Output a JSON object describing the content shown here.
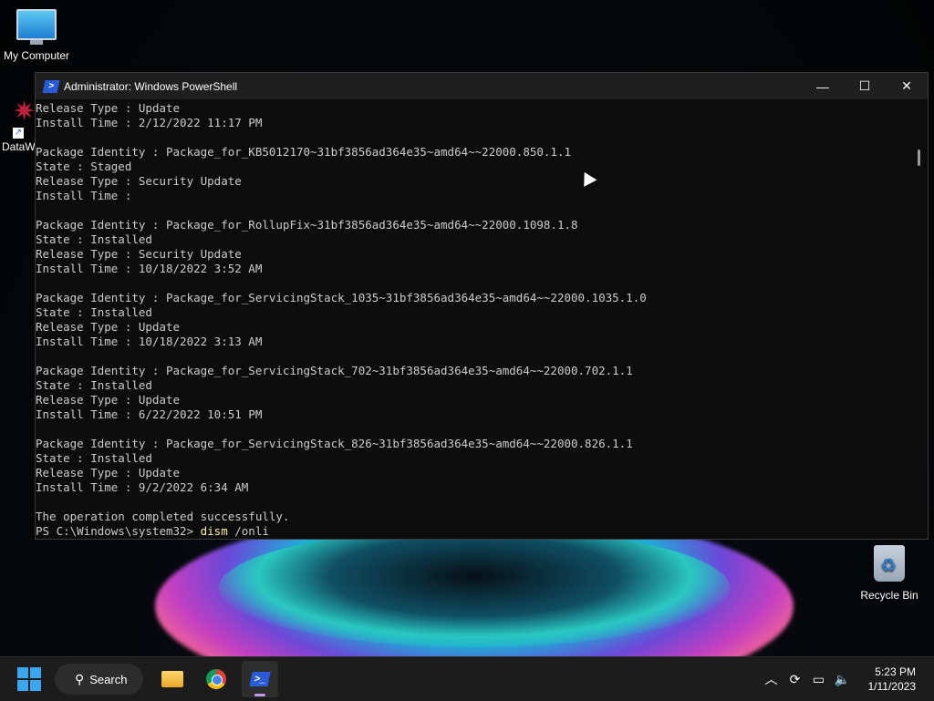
{
  "desktop": {
    "icons": [
      {
        "label": "My Computer"
      },
      {
        "label": "DataW"
      },
      {
        "label": "Recycle Bin"
      }
    ]
  },
  "window": {
    "title": "Administrator: Windows PowerShell",
    "controls": {
      "minimize": "—",
      "maximize": "☐",
      "close": "✕"
    }
  },
  "terminal": {
    "lines": [
      "Release Type : Update",
      "Install Time : 2/12/2022 11:17 PM",
      "",
      "Package Identity : Package_for_KB5012170~31bf3856ad364e35~amd64~~22000.850.1.1",
      "State : Staged",
      "Release Type : Security Update",
      "Install Time :",
      "",
      "Package Identity : Package_for_RollupFix~31bf3856ad364e35~amd64~~22000.1098.1.8",
      "State : Installed",
      "Release Type : Security Update",
      "Install Time : 10/18/2022 3:52 AM",
      "",
      "Package Identity : Package_for_ServicingStack_1035~31bf3856ad364e35~amd64~~22000.1035.1.0",
      "State : Installed",
      "Release Type : Update",
      "Install Time : 10/18/2022 3:13 AM",
      "",
      "Package Identity : Package_for_ServicingStack_702~31bf3856ad364e35~amd64~~22000.702.1.1",
      "State : Installed",
      "Release Type : Update",
      "Install Time : 6/22/2022 10:51 PM",
      "",
      "Package Identity : Package_for_ServicingStack_826~31bf3856ad364e35~amd64~~22000.826.1.1",
      "State : Installed",
      "Release Type : Update",
      "Install Time : 9/2/2022 6:34 AM",
      "",
      "The operation completed successfully."
    ],
    "prompt": "PS C:\\Windows\\system32> ",
    "command": "dism",
    "argument": " /onli"
  },
  "taskbar": {
    "search_label": "Search",
    "apps": [
      "file-explorer",
      "chrome",
      "powershell"
    ],
    "clock_time": "5:23 PM",
    "clock_date": "1/11/2023"
  },
  "colors": {
    "accent": "#3aa6ee",
    "terminal_bg": "#0c0c0c",
    "terminal_fg": "#cccccc",
    "command": "#f9f1a5"
  }
}
